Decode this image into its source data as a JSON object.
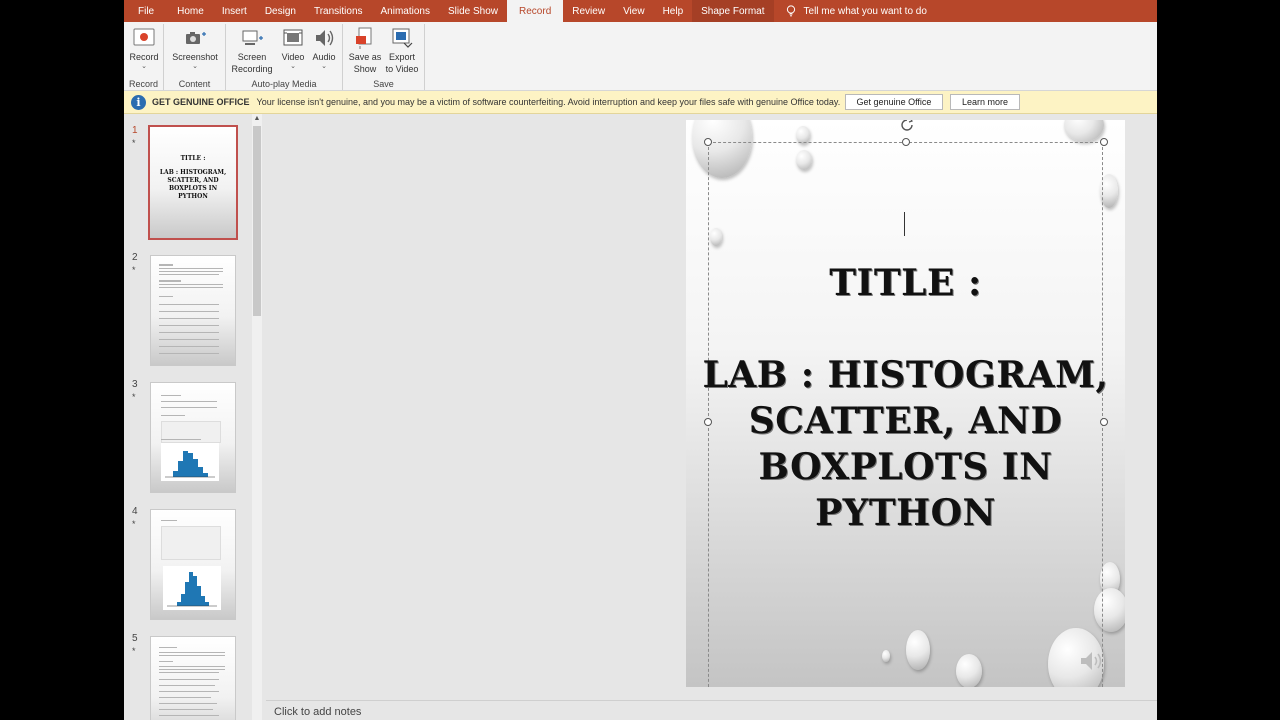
{
  "menu": {
    "tabs": [
      {
        "label": "File"
      },
      {
        "label": "Home"
      },
      {
        "label": "Insert"
      },
      {
        "label": "Design"
      },
      {
        "label": "Transitions"
      },
      {
        "label": "Animations"
      },
      {
        "label": "Slide Show"
      },
      {
        "label": "Record"
      },
      {
        "label": "Review"
      },
      {
        "label": "View"
      },
      {
        "label": "Help"
      },
      {
        "label": "Shape Format"
      }
    ],
    "active_tab": "Record",
    "tell_me": "Tell me what you want to do"
  },
  "ribbon": {
    "record": {
      "label": "Record",
      "group": "Record"
    },
    "screenshot": {
      "label": "Screenshot",
      "group": "Content"
    },
    "screen_recording": {
      "label1": "Screen",
      "label2": "Recording"
    },
    "video": {
      "label": "Video"
    },
    "audio": {
      "label": "Audio"
    },
    "autoplay_group": "Auto-play Media",
    "save_as_show": {
      "label1": "Save as",
      "label2": "Show"
    },
    "export_video": {
      "label1": "Export",
      "label2": "to Video"
    },
    "save_group": "Save"
  },
  "license": {
    "title": "GET GENUINE OFFICE",
    "message": "Your license isn't genuine, and you may be a victim of software counterfeiting. Avoid interruption and keep your files safe with genuine Office today.",
    "get_genuine": "Get genuine Office",
    "learn_more": "Learn more"
  },
  "thumbnails": [
    {
      "number": "1",
      "star": "*",
      "title_line1": "TITLE :",
      "title_line2": "LAB : HISTOGRAM, SCATTER, AND BOXPLOTS IN PYTHON"
    },
    {
      "number": "2",
      "star": "*"
    },
    {
      "number": "3",
      "star": "*"
    },
    {
      "number": "4",
      "star": "*"
    },
    {
      "number": "5",
      "star": "*"
    }
  ],
  "slide": {
    "title_line1": "TITLE :",
    "title_line2": "LAB : HISTOGRAM, SCATTER, AND BOXPLOTS IN PYTHON"
  },
  "notes": {
    "placeholder": "Click to add notes"
  },
  "colors": {
    "accent": "#b7472a",
    "license_bar": "#fdf3c4",
    "workspace": "#e6e6e6"
  }
}
